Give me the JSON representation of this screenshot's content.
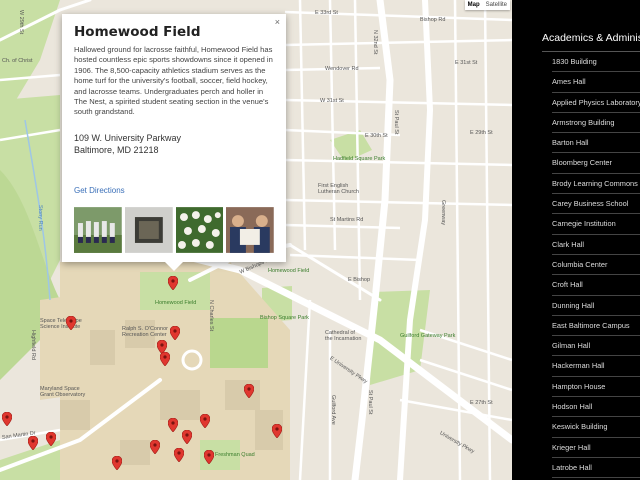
{
  "map": {
    "type_buttons": [
      "Map",
      "Satellite"
    ],
    "streets": {
      "e33rd": "E 33rd St",
      "bishop_top": "Bishop Rd",
      "wendover": "Wendover Rd",
      "w31st": "W 31st St",
      "e30th": "E 30th St",
      "e31st": "E 31st St",
      "e29th": "E 29th St",
      "stmartins": "St Martins Rd",
      "ebishop": "E Bishop",
      "w_bishop": "W Bishops St",
      "euniv": "E University Pkwy",
      "stpaul": "St Paul St",
      "n32nd": "N 32nd St",
      "stpaul2": "St Paul St",
      "greenway": "Greenway",
      "guilford_ave": "Guilford Ave",
      "stoney": "Stony Run",
      "w29th": "W 29th St",
      "sanmartin": "San Martin Dr",
      "n_charles": "N Charles St",
      "highfield": "Highfield Rd",
      "university": "University Pkwy",
      "eastlane": "E 27th St"
    },
    "places": {
      "church_christ": "Ch. of Christ",
      "charles_st_church": "Christ Church",
      "hadfield": "Hadfield Square Park",
      "lutheran": "First English\nLutheran Church",
      "bishop_sq": "Bishop Square Park",
      "cathedral": "Cathedral of\nthe Incarnation",
      "guilford_park": "Guilford Gateway Park",
      "homewood_field": "Homewood Field",
      "oconnor": "Ralph S. O'Connor\nRecreation Center",
      "space_telescope": "Space Telescope\nScience Institute",
      "maryland_space": "Maryland Space\nGrant Observatory",
      "freshman_quad": "Freshman Quad",
      "san_martin": "San Martin"
    }
  },
  "infowindow": {
    "title": "Homewood Field",
    "close": "×",
    "description": "Hallowed ground for lacrosse faithful, Homewood Field has hosted countless epic sports showdowns since it opened in 1906. The 8,500-capacity athletics stadium serves as the home turf for the university's football, soccer, field hockey, and lacrosse teams. Undergraduates perch and holler in The Nest, a spirited student seating section in the venue's south grandstand.",
    "address_line1": "109 W. University Parkway",
    "address_line2": "Baltimore, MD 21218",
    "directions": "Get Directions"
  },
  "sidebar": {
    "category": "Academics & Administration",
    "items": [
      "1830 Building",
      "Ames Hall",
      "Applied Physics Laboratory",
      "Armstrong Building",
      "Barton Hall",
      "Bloomberg Center",
      "Brody Learning Commons",
      "Carey Business School",
      "Carnegie Institution",
      "Clark Hall",
      "Columbia Center",
      "Croft Hall",
      "Dunning Hall",
      "East Baltimore Campus",
      "Gilman Hall",
      "Hackerman Hall",
      "Hampton House",
      "Hodson Hall",
      "Keswick Building",
      "Krieger Hall",
      "Latrobe Hall"
    ]
  },
  "colors": {
    "map_bg": "#ebe6dc",
    "park": "#c8dfa4",
    "campus": "#e5d8b8",
    "road": "#ffffff",
    "pin": "#e0372f",
    "link": "#3a6fb8"
  }
}
